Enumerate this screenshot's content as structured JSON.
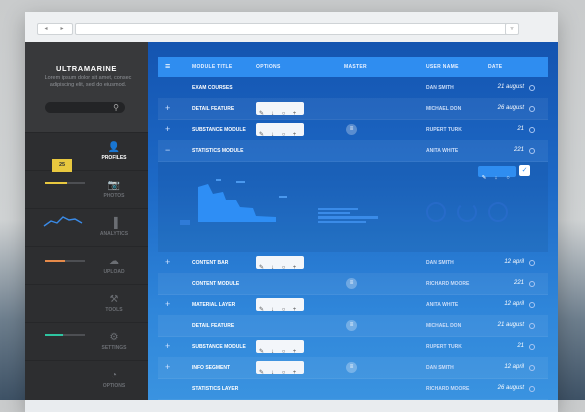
{
  "browser": {
    "nav_label": "◂  ▸",
    "menu_glyph": "▿"
  },
  "sidebar": {
    "brand": "ULTRAMARINE",
    "tagline": "Lorem ipsum dolor sit amet, consec adipiscing elit, sed do eiusmod.",
    "search_icon": "⚲",
    "tooltip_value": "25",
    "items": [
      {
        "label": "PROFILES",
        "icon": "👤",
        "active": true
      },
      {
        "label": "PHOTOS",
        "icon": "📷",
        "active": false
      },
      {
        "label": "ANALYTICS",
        "icon": "▐",
        "active": false
      },
      {
        "label": "UPLOAD",
        "icon": "☁",
        "active": false
      },
      {
        "label": "TOOLS",
        "icon": "⚒",
        "active": false
      },
      {
        "label": "SETTINGS",
        "icon": "⚙",
        "active": false
      },
      {
        "label": "OPTIONS",
        "icon": "◔",
        "active": false
      }
    ],
    "accents": {
      "yellow": "#e8c83f",
      "blue": "#3a8be8",
      "orange": "#e58a4a",
      "teal": "#2ec4a0"
    }
  },
  "table": {
    "headers": {
      "title": "MODULE TITLE",
      "options": "OPTIONS",
      "master": "MASTER",
      "user": "USER NAME",
      "date": "DATE"
    },
    "option_icons": [
      "✎",
      "↓",
      "○",
      "+"
    ],
    "rows_top": [
      {
        "title": "EXAM COURSES",
        "user": "DAN SMITH",
        "date": "21 august",
        "plus": false,
        "options": false,
        "master": false
      },
      {
        "title": "DETAIL FEATURE",
        "user": "MICHAEL DON",
        "date": "26 august",
        "plus": true,
        "options": true,
        "master": false
      },
      {
        "title": "SUBSTANCE MODULE",
        "user": "RUPERT TURK",
        "date": "21",
        "plus": true,
        "options": true,
        "master": true
      },
      {
        "title": "STATISTICS MODULE",
        "user": "ANITA WHITE",
        "date": "221",
        "plus": false,
        "options": false,
        "master": false
      }
    ],
    "rows_bottom": [
      {
        "title": "CONTENT BAR",
        "user": "DAN SMITH",
        "date": "12 april",
        "plus": true,
        "options": true,
        "master": false
      },
      {
        "title": "CONTENT MODULE",
        "user": "RICHARD MOORE",
        "date": "221",
        "plus": false,
        "options": false,
        "master": true
      },
      {
        "title": "MATERIAL LAYER",
        "user": "ANITA WHITE",
        "date": "12 april",
        "plus": true,
        "options": true,
        "master": false
      },
      {
        "title": "DETAIL FEATURE",
        "user": "MICHAEL DON",
        "date": "21 august",
        "plus": false,
        "options": false,
        "master": true
      },
      {
        "title": "SUBSTANCE MODULE",
        "user": "RUPERT TURK",
        "date": "21",
        "plus": true,
        "options": true,
        "master": false
      },
      {
        "title": "INFO SEGMENT",
        "user": "DAN SMITH",
        "date": "12 april",
        "plus": true,
        "options": true,
        "master": true
      },
      {
        "title": "STATISTICS LAYER",
        "user": "RICHARD MOORE",
        "date": "26 august",
        "plus": false,
        "options": false,
        "master": false
      }
    ],
    "detail_actions": {
      "edit": "✎",
      "delete": "↓",
      "view": "○",
      "confirm": "✓"
    },
    "collapse_glyph": "−",
    "expand_glyph": "+",
    "menu_glyph": "≡"
  }
}
